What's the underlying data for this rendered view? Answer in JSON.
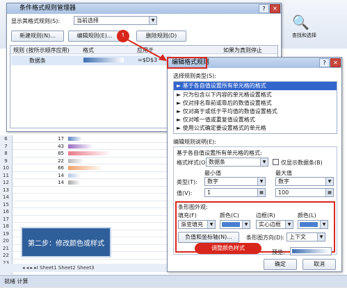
{
  "ribbon": {
    "right_icon_label": "查找和选择"
  },
  "sheet": {
    "rows": [
      "6",
      "7",
      "8",
      "9",
      "10",
      "11",
      "12",
      "13",
      "14",
      "15",
      "16",
      "17",
      "18",
      "19",
      "20",
      "21",
      "22",
      "23"
    ],
    "values": [
      {
        "value": "17",
        "color": "#5f86c4"
      },
      {
        "value": "43",
        "color": "#9b6cbf"
      },
      {
        "value": "85",
        "color": "#e87b8a"
      },
      {
        "value": "22",
        "color": "#b9b9b9"
      },
      {
        "value": "66",
        "color": "#f0a26a"
      },
      {
        "value": "14",
        "color": "#b6c8e8"
      },
      {
        "value": "14",
        "color": "#a9a9a9"
      }
    ],
    "step_label": "第二步：修改颜色或样式",
    "tabs": "◂ ◂ ▸ ▸I  Sheet1  Sheet2  Sheet3",
    "status": "就绪   计算"
  },
  "manager": {
    "title": "条件格式规则管理器",
    "show_rules_label": "显示其格式规则(S):",
    "show_rules_value": "当前选择",
    "new_rule": "新建规则(N)...",
    "edit_rule": "编辑规则(E)...",
    "delete_rule": "删除规则(D)",
    "col_rule": "规则 (按所示顺序应用)",
    "col_format": "格式",
    "col_applies": "应用于",
    "col_stop": "如果为真则停止",
    "rule_name": "数据条",
    "rule_range": "=$D$3",
    "callout": "1"
  },
  "editor": {
    "title": "编辑格式规则",
    "rule_type_label": "选择规则类型(S):",
    "rule_types": [
      "► 基于各自值设置所有单元格的格式",
      "► 只为包含以下内容的单元格设置格式",
      "► 仅对排名靠前或靠后的数值设置格式",
      "► 仅对高于或低于平均值的数值设置格式",
      "► 仅对唯一值或重复值设置格式",
      "► 使用公式确定要设置格式的单元格"
    ],
    "desc_label": "编辑规则说明(E):",
    "desc_heading": "基于各自值设置所有单元格的格式:",
    "format_style_label": "格式样式(O):",
    "format_style_value": "数据条",
    "show_bar_only": "仅显示数据条(B)",
    "min_label": "最小值",
    "max_label": "最大值",
    "type_label": "类型(T):",
    "min_type": "数字",
    "max_type": "数字",
    "value_label": "值(V):",
    "min_value": "1",
    "max_value": "100",
    "bar_appearance": "条形图外观:",
    "fill_label": "填充(F)",
    "fill_value": "渐变填充",
    "color_label": "颜色(C)",
    "border_label": "边框(R)",
    "border_value": "实心边框",
    "color2_label": "颜色(L)",
    "negative_button": "负值和坐标轴(N)...",
    "direction_label": "条形图方向(D):",
    "direction_value": "上下文",
    "preview_label": "预览:",
    "ok": "确定",
    "cancel": "取消",
    "adjust_tag": "调整颜色样式",
    "fill_color": "#4a7fd0"
  }
}
